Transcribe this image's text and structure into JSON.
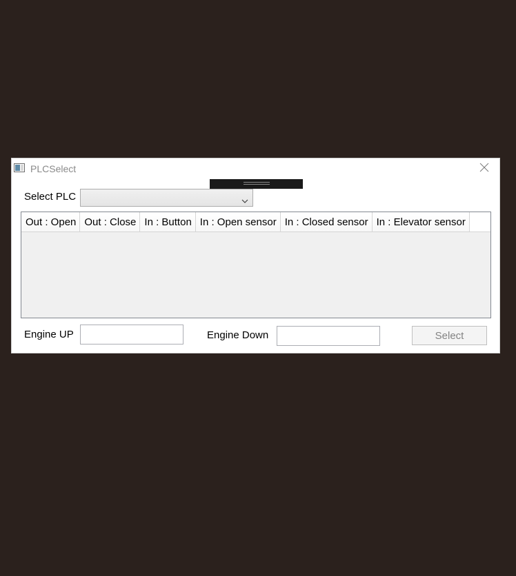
{
  "window": {
    "title": "PLCSelect",
    "icon": "app-window-icon",
    "close_icon": "close-icon"
  },
  "plc": {
    "label": "Select PLC",
    "selected": "",
    "icon": "chevron-down-icon"
  },
  "grid": {
    "columns": [
      "Out : Open",
      "Out : Close",
      "In : Button",
      "In : Open sensor",
      "In : Closed sensor",
      "In : Elevator sensor"
    ],
    "rows": []
  },
  "engine_up": {
    "label": "Engine UP",
    "value": ""
  },
  "engine_down": {
    "label": "Engine Down",
    "value": ""
  },
  "select_button": {
    "label": "Select",
    "enabled": false
  },
  "colors": {
    "desktop_background": "#2b211d",
    "window_background": "#ffffff",
    "grid_background": "#f0f0f0",
    "disabled_text": "#838383"
  }
}
